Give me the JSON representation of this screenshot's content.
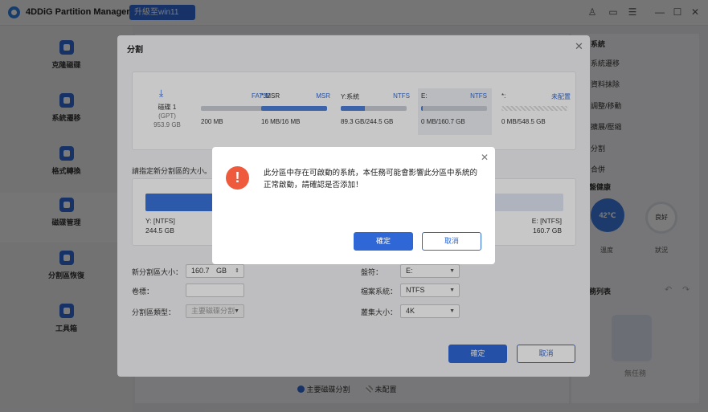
{
  "app": {
    "title": "4DDiG Partition Manager",
    "upgrade_label": "升級至win11"
  },
  "window_controls": {
    "user": "♙",
    "message": "▭",
    "menu": "☰",
    "minimize": "—",
    "maximize": "☐",
    "close": "✕"
  },
  "sidebar": {
    "items": [
      {
        "label": "克隆磁碟"
      },
      {
        "label": "系統遷移"
      },
      {
        "label": "格式轉換"
      },
      {
        "label": "磁碟管理"
      },
      {
        "label": "分割區恢復"
      },
      {
        "label": "工具箱"
      }
    ]
  },
  "right_panel": {
    "section_partial": "系統",
    "items": [
      "系統遷移",
      "資料抹除",
      "調整/移動",
      "擴展/壓縮",
      "分割",
      "合併"
    ],
    "health_partial": "盤健康",
    "temp_value": "42℃",
    "temp_label": "溫度",
    "status_value": "良好",
    "status_label": "狀況",
    "task_partial": "務列表",
    "no_task": "無任務"
  },
  "legend": {
    "primary": "主要磁碟分割",
    "unallocated": "未配置"
  },
  "dialog": {
    "title": "分割",
    "disk": {
      "name": "磁碟 1",
      "type": "(GPT)",
      "size": "953.9 GB"
    },
    "partitions": [
      {
        "name": "",
        "fs": "FAT32",
        "size": "200 MB",
        "fill": 0
      },
      {
        "name": "*:MSR",
        "fs": "MSR",
        "size": "16 MB/16 MB",
        "fill": 100
      },
      {
        "name": "Y:系統",
        "fs": "NTFS",
        "size": "89.3 GB/244.5 GB",
        "fill": 36
      },
      {
        "name": "E:",
        "fs": "NTFS",
        "size": "0 MB/160.7 GB",
        "fill": 2
      },
      {
        "name": "*:",
        "fs": "未配置",
        "size": "0 MB/548.5 GB",
        "fill": 0
      }
    ],
    "prompt": "請指定新分割區的大小。",
    "slider": {
      "left_name": "Y: [NTFS]",
      "left_size": "244.5 GB",
      "right_name": "E: [NTFS]",
      "right_size": "160.7 GB"
    },
    "form": {
      "size_label": "新分割區大小：",
      "size_value": "160.7",
      "size_unit": "GB",
      "volume_label": "卷標：",
      "volume_value": "",
      "type_label": "分割區類型：",
      "type_value": "主要磁碟分割",
      "drive_label": "盤符：",
      "drive_value": "E:",
      "fs_label": "檔案系統：",
      "fs_value": "NTFS",
      "cluster_label": "叢集大小：",
      "cluster_value": "4K"
    },
    "ok": "確定",
    "cancel": "取消"
  },
  "alert": {
    "message": "此分區中存在可啟動的系統，本任務可能會影響此分區中系統的正常啟動，請確認是否添加！",
    "ok": "確定",
    "cancel": "取消",
    "icon": "warning-icon"
  }
}
